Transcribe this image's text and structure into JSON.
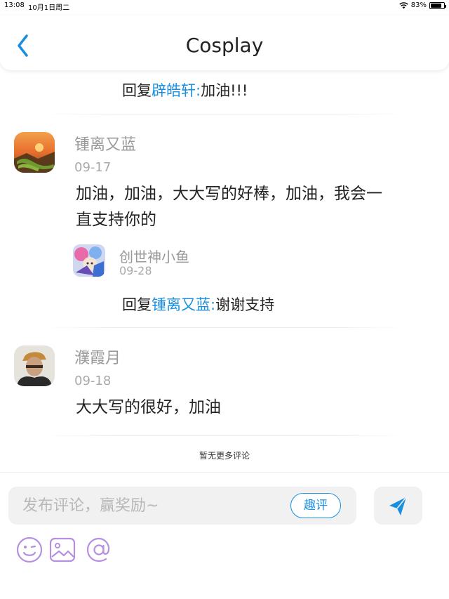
{
  "status_bar": {
    "time": "13:08",
    "date": "10月1日周二",
    "battery": "83%",
    "battery_level": 0.83
  },
  "nav": {
    "title": "Cosplay",
    "back_icon": "chevron-left-icon"
  },
  "top_reply": {
    "prefix": "回复",
    "name": "辟皓轩:",
    "text": "加油!!!"
  },
  "comments": [
    {
      "author": "锺离又蓝",
      "date": "09-17",
      "body_line1": "加油，加油，大大写的好棒，加油，我会一",
      "body_line2": "直支持你的",
      "reply": {
        "author": "创世神小鱼",
        "date": "09-28",
        "prefix": "回复",
        "name": "锺离又蓝:",
        "text": "谢谢支持"
      }
    },
    {
      "author": "濮霞月",
      "date": "09-18",
      "body_line1": "大大写的很好，加油"
    }
  ],
  "no_more": "暂无更多评论",
  "composer": {
    "placeholder": "发布评论，赢奖励~",
    "qp_label": "趣评",
    "send_icon": "send-icon",
    "tools": [
      "emoji-icon",
      "image-icon",
      "at-icon"
    ]
  },
  "colors": {
    "accent": "#1a8fe0",
    "tool": "#b58fe0"
  }
}
